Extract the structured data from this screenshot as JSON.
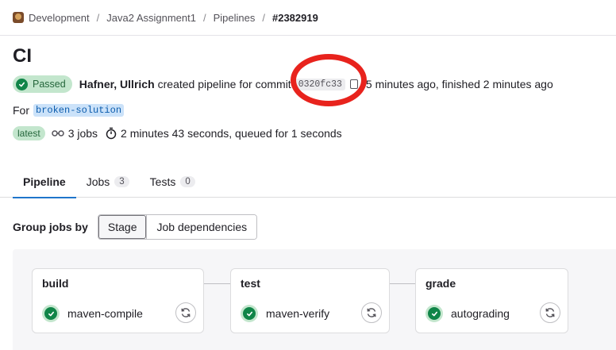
{
  "breadcrumb": {
    "items": [
      "Development",
      "Java2 Assignment1",
      "Pipelines"
    ],
    "current": "#2382919",
    "separator": "/"
  },
  "title": "CI",
  "status": {
    "badge": "Passed",
    "author": "Hafner, Ullrich",
    "action_text": "created pipeline for commit",
    "commit_sha": "0320fc33",
    "time_text": "5 minutes ago, finished 2 minutes ago"
  },
  "ref": {
    "prefix": "For",
    "branch": "broken-solution"
  },
  "meta": {
    "latest_badge": "latest",
    "jobs_text": "3 jobs",
    "duration_text": "2 minutes 43 seconds, queued for 1 seconds"
  },
  "tabs": [
    {
      "label": "Pipeline",
      "count": null
    },
    {
      "label": "Jobs",
      "count": "3"
    },
    {
      "label": "Tests",
      "count": "0"
    }
  ],
  "group_jobs": {
    "label": "Group jobs by",
    "options": [
      "Stage",
      "Job dependencies"
    ],
    "selected": "Stage"
  },
  "stages": [
    {
      "name": "build",
      "job": "maven-compile",
      "status": "passed"
    },
    {
      "name": "test",
      "job": "maven-verify",
      "status": "passed"
    },
    {
      "name": "grade",
      "job": "autograding",
      "status": "passed"
    }
  ],
  "colors": {
    "success": "#108548",
    "success_bg": "#c3e6cd",
    "link": "#1f75cb",
    "annotation": "#e8231d"
  },
  "icons": {
    "avatar": "project-avatar",
    "status": "check-circle-icon",
    "copy": "copy-icon",
    "jobs": "pipeline-icon",
    "duration": "timer-icon",
    "retry": "retry-icon"
  }
}
